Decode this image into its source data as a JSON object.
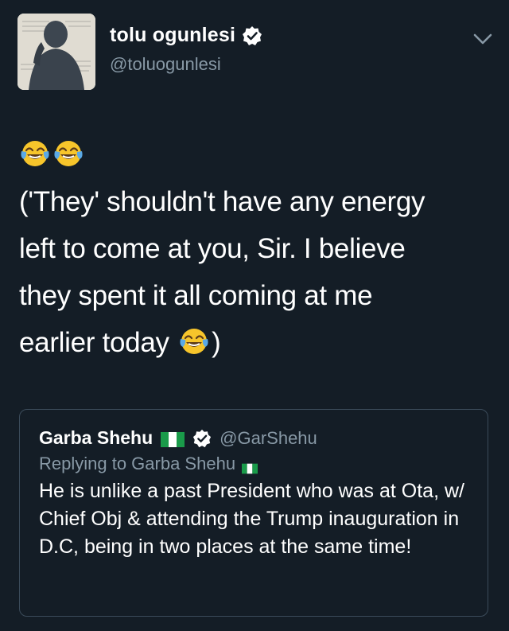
{
  "author": {
    "display_name": "tolu ogunlesi",
    "handle": "@toluogunlesi"
  },
  "tweet": {
    "line1": "('They' shouldn't have any energy",
    "line2": "left to come at you, Sir. I believe",
    "line3": "they spent it all coming at me",
    "line4_prefix": "earlier today",
    "line4_suffix": ")"
  },
  "quoted_tweet": {
    "display_name": "Garba Shehu",
    "handle": "@GarShehu",
    "replying_to": "Replying to Garba Shehu",
    "text": "He is unlike a past President who was at Ota, w/ Chief Obj & attending the Trump inauguration in D.C, being in two places at the same time!"
  },
  "icons": {
    "verified": "verified-badge-icon",
    "menu": "chevron-down-icon",
    "emoji": "face-with-tears-of-joy-icon",
    "flag": "nigeria-flag-icon"
  },
  "colors": {
    "background": "#141d26",
    "secondary_text": "#8899a6",
    "card_border": "#3b4b5a"
  }
}
